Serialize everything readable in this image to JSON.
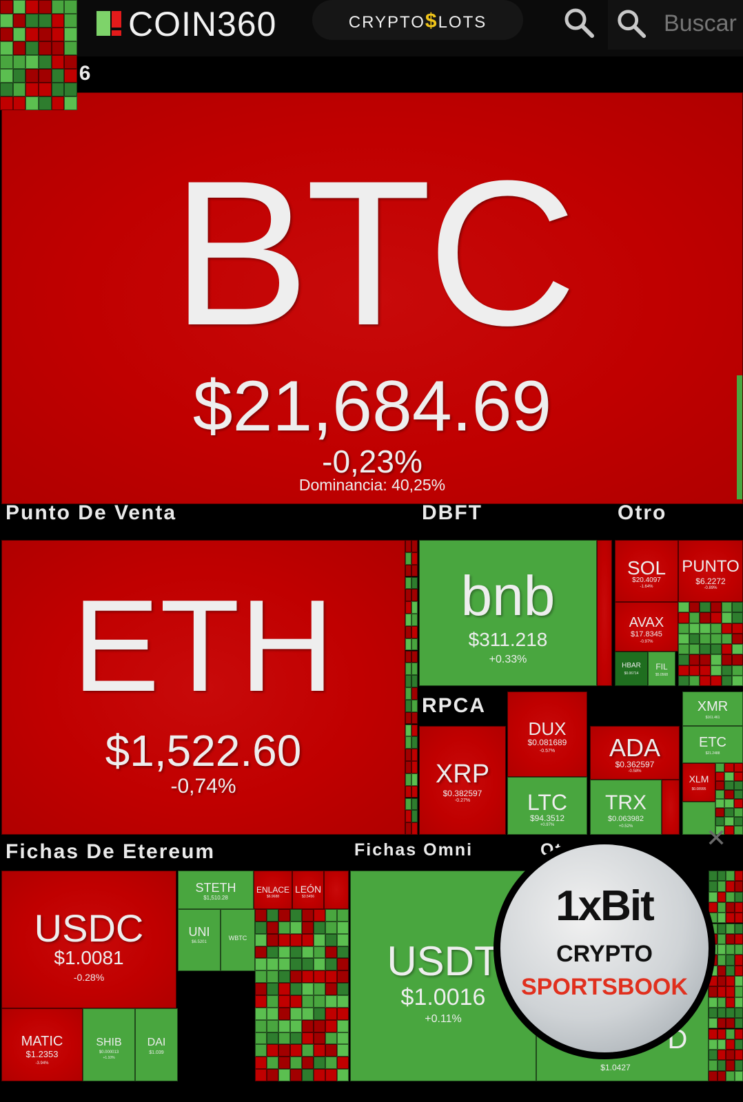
{
  "header": {
    "logo_text": "COIN360",
    "promo_text_a": "CRYPTO",
    "promo_text_b": "$",
    "promo_text_c": "LOTS",
    "search_placeholder": "Buscar",
    "icons": [
      "menu-icon",
      "search-icon"
    ]
  },
  "sections": {
    "sha256": "SHA256",
    "pos": "Punto De Venta",
    "dbft": "DBFT",
    "other": "Otro",
    "rpca": "RPCA",
    "eth_tokens": "Fichas De Etereum",
    "omni": "Fichas Omni",
    "other2": "Ot"
  },
  "btc": {
    "symbol": "BTC",
    "price": "$21,684.69",
    "change": "-0,23%",
    "dominance": "Dominancia: 40,25%"
  },
  "eth": {
    "symbol": "ETH",
    "price": "$1,522.60",
    "change": "-0,74%"
  },
  "bnb": {
    "symbol": "bnb",
    "price": "$311.218",
    "change": "+0.33%"
  },
  "sol": {
    "symbol": "SOL",
    "price": "$20.4097",
    "change": "-1.64%"
  },
  "punto": {
    "symbol": "PUNTO",
    "price": "$6.2272",
    "change": "-0.89%"
  },
  "avax": {
    "symbol": "AVAX",
    "price": "$17.8345",
    "change": "-0.97%"
  },
  "hbar": {
    "symbol": "HBAR",
    "price": "$0.06714"
  },
  "fil": {
    "symbol": "FIL",
    "price": "$5.0568"
  },
  "xrp": {
    "symbol": "XRP",
    "price": "$0.382597",
    "change": "-0.27%"
  },
  "dux": {
    "symbol": "DUX",
    "price": "$0.081689",
    "change": "-0.57%"
  },
  "ada": {
    "symbol": "ADA",
    "price": "$0.362597",
    "change": "-0.58%"
  },
  "ltc": {
    "symbol": "LTC",
    "price": "$94.3512",
    "change": "+0.97%"
  },
  "trx": {
    "symbol": "TRX",
    "price": "$0.063982",
    "change": "+0.52%"
  },
  "xmr": {
    "symbol": "XMR",
    "price": "$161.461"
  },
  "etc": {
    "symbol": "ETC",
    "price": "$21.2488"
  },
  "xlm": {
    "symbol": "XLM",
    "price": "$0.08995"
  },
  "usdc": {
    "symbol": "USDC",
    "price": "$1.0081",
    "change": "-0.28%"
  },
  "steth": {
    "symbol": "STETH",
    "price": "$1,510.28"
  },
  "enlace": {
    "symbol": "ENLACE",
    "price": "$6.9688"
  },
  "leon": {
    "symbol": "LEÓN",
    "price": "$3.5456"
  },
  "uni": {
    "symbol": "UNI",
    "price": "$6.5201"
  },
  "wbtc": {
    "symbol": "WBTC"
  },
  "matic": {
    "symbol": "MATIC",
    "price": "$1.2353",
    "change": "-3.94%"
  },
  "shib": {
    "symbol": "SHIB",
    "price": "$0.000013",
    "change": "+1.10%"
  },
  "dai": {
    "symbol": "DAI",
    "price": "$1.039"
  },
  "usdt": {
    "symbol": "USDT",
    "price": "$1.0016",
    "change": "+0.11%"
  },
  "busd": {
    "symbol": "D",
    "price": "$1.0427"
  },
  "ad": {
    "brand": "1xBit",
    "line2": "CRYPTO",
    "line3": "SPORTSBOOK",
    "close": "✕"
  },
  "colors": {
    "up": "#49a63f",
    "down": "#c00000",
    "deep_down": "#a10000"
  }
}
